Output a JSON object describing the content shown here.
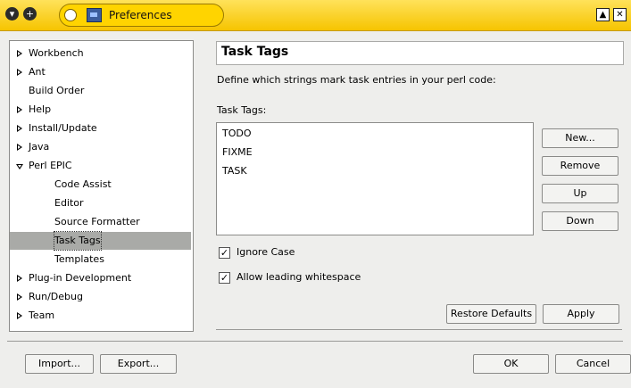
{
  "window": {
    "title": "Preferences",
    "left_buttons": [
      "▾",
      "+"
    ],
    "right_buttons": [
      "▲",
      "✕"
    ]
  },
  "tree": {
    "items": [
      {
        "label": "Workbench",
        "indent": 0,
        "expander": "closed"
      },
      {
        "label": "Ant",
        "indent": 0,
        "expander": "closed"
      },
      {
        "label": "Build Order",
        "indent": 0,
        "expander": "none"
      },
      {
        "label": "Help",
        "indent": 0,
        "expander": "closed"
      },
      {
        "label": "Install/Update",
        "indent": 0,
        "expander": "closed"
      },
      {
        "label": "Java",
        "indent": 0,
        "expander": "closed"
      },
      {
        "label": "Perl EPIC",
        "indent": 0,
        "expander": "open"
      },
      {
        "label": "Code Assist",
        "indent": 1,
        "expander": "none"
      },
      {
        "label": "Editor",
        "indent": 1,
        "expander": "none"
      },
      {
        "label": "Source Formatter",
        "indent": 1,
        "expander": "none"
      },
      {
        "label": "Task Tags",
        "indent": 1,
        "expander": "none",
        "selected": true
      },
      {
        "label": "Templates",
        "indent": 1,
        "expander": "none"
      },
      {
        "label": "Plug-in Development",
        "indent": 0,
        "expander": "closed"
      },
      {
        "label": "Run/Debug",
        "indent": 0,
        "expander": "closed"
      },
      {
        "label": "Team",
        "indent": 0,
        "expander": "closed"
      }
    ]
  },
  "page": {
    "title": "Task Tags",
    "description": "Define which strings mark task entries in your perl code:",
    "list_label": "Task Tags:",
    "tags": [
      "TODO",
      "FIXME",
      "TASK"
    ],
    "side_buttons": [
      "New...",
      "Remove",
      "Up",
      "Down"
    ],
    "ignore_case": {
      "label": "Ignore Case",
      "checked": true
    },
    "allow_whitespace": {
      "label": "Allow leading whitespace",
      "checked": true
    },
    "restore_defaults": "Restore Defaults",
    "apply": "Apply"
  },
  "footer": {
    "import": "Import...",
    "export": "Export...",
    "ok": "OK",
    "cancel": "Cancel"
  },
  "colors": {
    "titlebar": "#f6c400",
    "selection": "#a9aaa7",
    "background": "#eeeeec"
  },
  "check_glyph": "✓"
}
